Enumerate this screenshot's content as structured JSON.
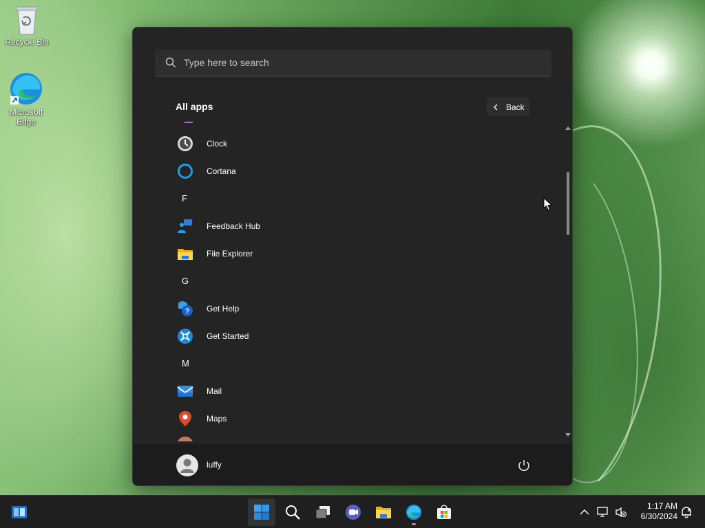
{
  "desktop": {
    "icons": [
      {
        "name": "recycle-bin",
        "label": "Recycle Bin"
      },
      {
        "name": "microsoft-edge",
        "label": "Microsoft Edge"
      }
    ]
  },
  "start_menu": {
    "search_placeholder": "Type here to search",
    "all_apps_title": "All apps",
    "back_label": "Back",
    "apps": [
      {
        "type": "app",
        "label": "Clock",
        "icon": "clock-icon"
      },
      {
        "type": "app",
        "label": "Cortana",
        "icon": "cortana-icon"
      },
      {
        "type": "letter",
        "label": "F"
      },
      {
        "type": "app",
        "label": "Feedback Hub",
        "icon": "feedback-hub-icon"
      },
      {
        "type": "app",
        "label": "File Explorer",
        "icon": "file-explorer-icon"
      },
      {
        "type": "letter",
        "label": "G"
      },
      {
        "type": "app",
        "label": "Get Help",
        "icon": "get-help-icon"
      },
      {
        "type": "app",
        "label": "Get Started",
        "icon": "get-started-icon"
      },
      {
        "type": "letter",
        "label": "M"
      },
      {
        "type": "app",
        "label": "Mail",
        "icon": "mail-icon"
      },
      {
        "type": "app",
        "label": "Maps",
        "icon": "maps-icon"
      }
    ],
    "user": {
      "name": "luffy"
    }
  },
  "taskbar": {
    "items": [
      "widgets-icon",
      "start-icon",
      "search-icon",
      "task-view-icon",
      "chat-icon",
      "file-explorer-icon",
      "edge-icon",
      "store-icon"
    ],
    "clock": {
      "time": "1:17 AM",
      "date": "6/30/2024"
    }
  },
  "colors": {
    "menu_bg": "#242424",
    "taskbar_bg": "#1f1f1f",
    "accent": "#0078d4"
  }
}
